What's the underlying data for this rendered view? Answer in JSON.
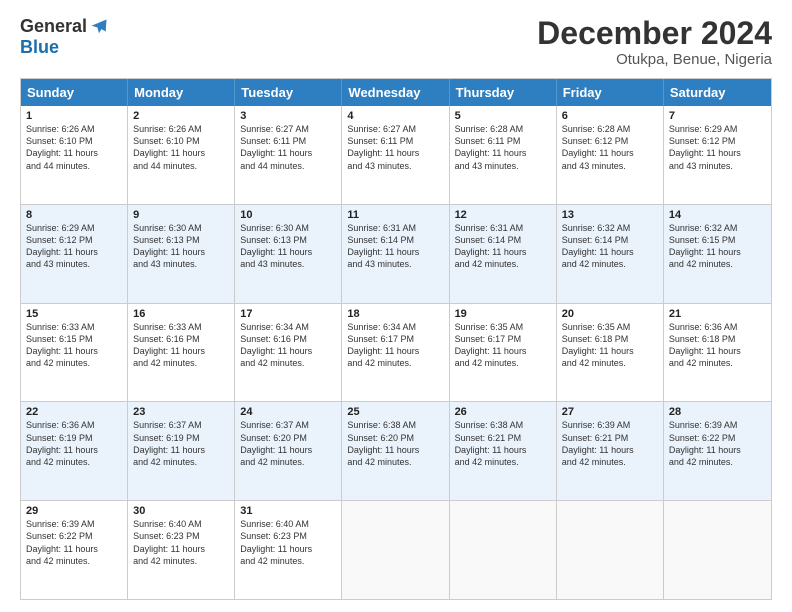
{
  "header": {
    "logo_general": "General",
    "logo_blue": "Blue",
    "main_title": "December 2024",
    "subtitle": "Otukpa, Benue, Nigeria"
  },
  "calendar": {
    "days": [
      "Sunday",
      "Monday",
      "Tuesday",
      "Wednesday",
      "Thursday",
      "Friday",
      "Saturday"
    ],
    "rows": [
      {
        "alt": false,
        "cells": [
          {
            "day": "1",
            "sunrise": "6:26 AM",
            "sunset": "6:10 PM",
            "daylight": "11 hours and 44 minutes."
          },
          {
            "day": "2",
            "sunrise": "6:26 AM",
            "sunset": "6:10 PM",
            "daylight": "11 hours and 44 minutes."
          },
          {
            "day": "3",
            "sunrise": "6:27 AM",
            "sunset": "6:11 PM",
            "daylight": "11 hours and 44 minutes."
          },
          {
            "day": "4",
            "sunrise": "6:27 AM",
            "sunset": "6:11 PM",
            "daylight": "11 hours and 43 minutes."
          },
          {
            "day": "5",
            "sunrise": "6:28 AM",
            "sunset": "6:11 PM",
            "daylight": "11 hours and 43 minutes."
          },
          {
            "day": "6",
            "sunrise": "6:28 AM",
            "sunset": "6:12 PM",
            "daylight": "11 hours and 43 minutes."
          },
          {
            "day": "7",
            "sunrise": "6:29 AM",
            "sunset": "6:12 PM",
            "daylight": "11 hours and 43 minutes."
          }
        ]
      },
      {
        "alt": true,
        "cells": [
          {
            "day": "8",
            "sunrise": "6:29 AM",
            "sunset": "6:12 PM",
            "daylight": "11 hours and 43 minutes."
          },
          {
            "day": "9",
            "sunrise": "6:30 AM",
            "sunset": "6:13 PM",
            "daylight": "11 hours and 43 minutes."
          },
          {
            "day": "10",
            "sunrise": "6:30 AM",
            "sunset": "6:13 PM",
            "daylight": "11 hours and 43 minutes."
          },
          {
            "day": "11",
            "sunrise": "6:31 AM",
            "sunset": "6:14 PM",
            "daylight": "11 hours and 43 minutes."
          },
          {
            "day": "12",
            "sunrise": "6:31 AM",
            "sunset": "6:14 PM",
            "daylight": "11 hours and 42 minutes."
          },
          {
            "day": "13",
            "sunrise": "6:32 AM",
            "sunset": "6:14 PM",
            "daylight": "11 hours and 42 minutes."
          },
          {
            "day": "14",
            "sunrise": "6:32 AM",
            "sunset": "6:15 PM",
            "daylight": "11 hours and 42 minutes."
          }
        ]
      },
      {
        "alt": false,
        "cells": [
          {
            "day": "15",
            "sunrise": "6:33 AM",
            "sunset": "6:15 PM",
            "daylight": "11 hours and 42 minutes."
          },
          {
            "day": "16",
            "sunrise": "6:33 AM",
            "sunset": "6:16 PM",
            "daylight": "11 hours and 42 minutes."
          },
          {
            "day": "17",
            "sunrise": "6:34 AM",
            "sunset": "6:16 PM",
            "daylight": "11 hours and 42 minutes."
          },
          {
            "day": "18",
            "sunrise": "6:34 AM",
            "sunset": "6:17 PM",
            "daylight": "11 hours and 42 minutes."
          },
          {
            "day": "19",
            "sunrise": "6:35 AM",
            "sunset": "6:17 PM",
            "daylight": "11 hours and 42 minutes."
          },
          {
            "day": "20",
            "sunrise": "6:35 AM",
            "sunset": "6:18 PM",
            "daylight": "11 hours and 42 minutes."
          },
          {
            "day": "21",
            "sunrise": "6:36 AM",
            "sunset": "6:18 PM",
            "daylight": "11 hours and 42 minutes."
          }
        ]
      },
      {
        "alt": true,
        "cells": [
          {
            "day": "22",
            "sunrise": "6:36 AM",
            "sunset": "6:19 PM",
            "daylight": "11 hours and 42 minutes."
          },
          {
            "day": "23",
            "sunrise": "6:37 AM",
            "sunset": "6:19 PM",
            "daylight": "11 hours and 42 minutes."
          },
          {
            "day": "24",
            "sunrise": "6:37 AM",
            "sunset": "6:20 PM",
            "daylight": "11 hours and 42 minutes."
          },
          {
            "day": "25",
            "sunrise": "6:38 AM",
            "sunset": "6:20 PM",
            "daylight": "11 hours and 42 minutes."
          },
          {
            "day": "26",
            "sunrise": "6:38 AM",
            "sunset": "6:21 PM",
            "daylight": "11 hours and 42 minutes."
          },
          {
            "day": "27",
            "sunrise": "6:39 AM",
            "sunset": "6:21 PM",
            "daylight": "11 hours and 42 minutes."
          },
          {
            "day": "28",
            "sunrise": "6:39 AM",
            "sunset": "6:22 PM",
            "daylight": "11 hours and 42 minutes."
          }
        ]
      },
      {
        "alt": false,
        "cells": [
          {
            "day": "29",
            "sunrise": "6:39 AM",
            "sunset": "6:22 PM",
            "daylight": "11 hours and 42 minutes."
          },
          {
            "day": "30",
            "sunrise": "6:40 AM",
            "sunset": "6:23 PM",
            "daylight": "11 hours and 42 minutes."
          },
          {
            "day": "31",
            "sunrise": "6:40 AM",
            "sunset": "6:23 PM",
            "daylight": "11 hours and 42 minutes."
          },
          {
            "day": "",
            "sunrise": "",
            "sunset": "",
            "daylight": ""
          },
          {
            "day": "",
            "sunrise": "",
            "sunset": "",
            "daylight": ""
          },
          {
            "day": "",
            "sunrise": "",
            "sunset": "",
            "daylight": ""
          },
          {
            "day": "",
            "sunrise": "",
            "sunset": "",
            "daylight": ""
          }
        ]
      }
    ]
  }
}
